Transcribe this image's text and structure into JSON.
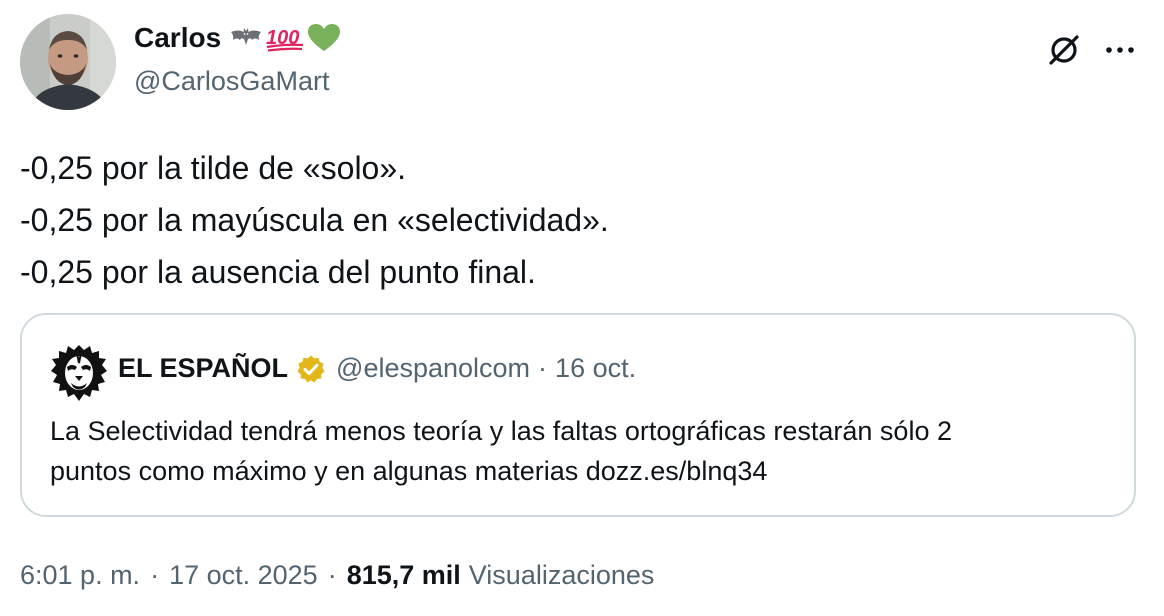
{
  "author": {
    "name": "Carlos",
    "name_emojis": [
      "bat-emoji",
      "hundred-points-emoji",
      "green-heart-emoji"
    ],
    "handle": "@CarlosGaMart"
  },
  "tweet": {
    "lines": [
      "-0,25 por la tilde de «solo».",
      "-0,25 por la mayúscula en «selectividad».",
      "-0,25 por la ausencia del punto final."
    ]
  },
  "quote": {
    "name": "EL ESPAÑOL",
    "verified": true,
    "handle": "@elespanolcom",
    "separator": "·",
    "date": "16 oct.",
    "text_line1": "La Selectividad tendrá menos teoría y las faltas ortográficas restarán sólo 2",
    "text_line2": "puntos como máximo y en algunas materias dozz.es/blnq34"
  },
  "meta": {
    "time": "6:01 p. m.",
    "separator": "·",
    "date": "17 oct. 2025",
    "views_count": "815,7 mil",
    "views_label": "Visualizaciones"
  },
  "colors": {
    "text_primary": "#0f1419",
    "text_secondary": "#536471",
    "card_border": "#cfd9de",
    "verified_gold": "#e2b719",
    "heart_green": "#78b159",
    "hundred_red": "#e0245e"
  },
  "icons": {
    "grok": "grok-icon",
    "more": "more-options-icon"
  }
}
